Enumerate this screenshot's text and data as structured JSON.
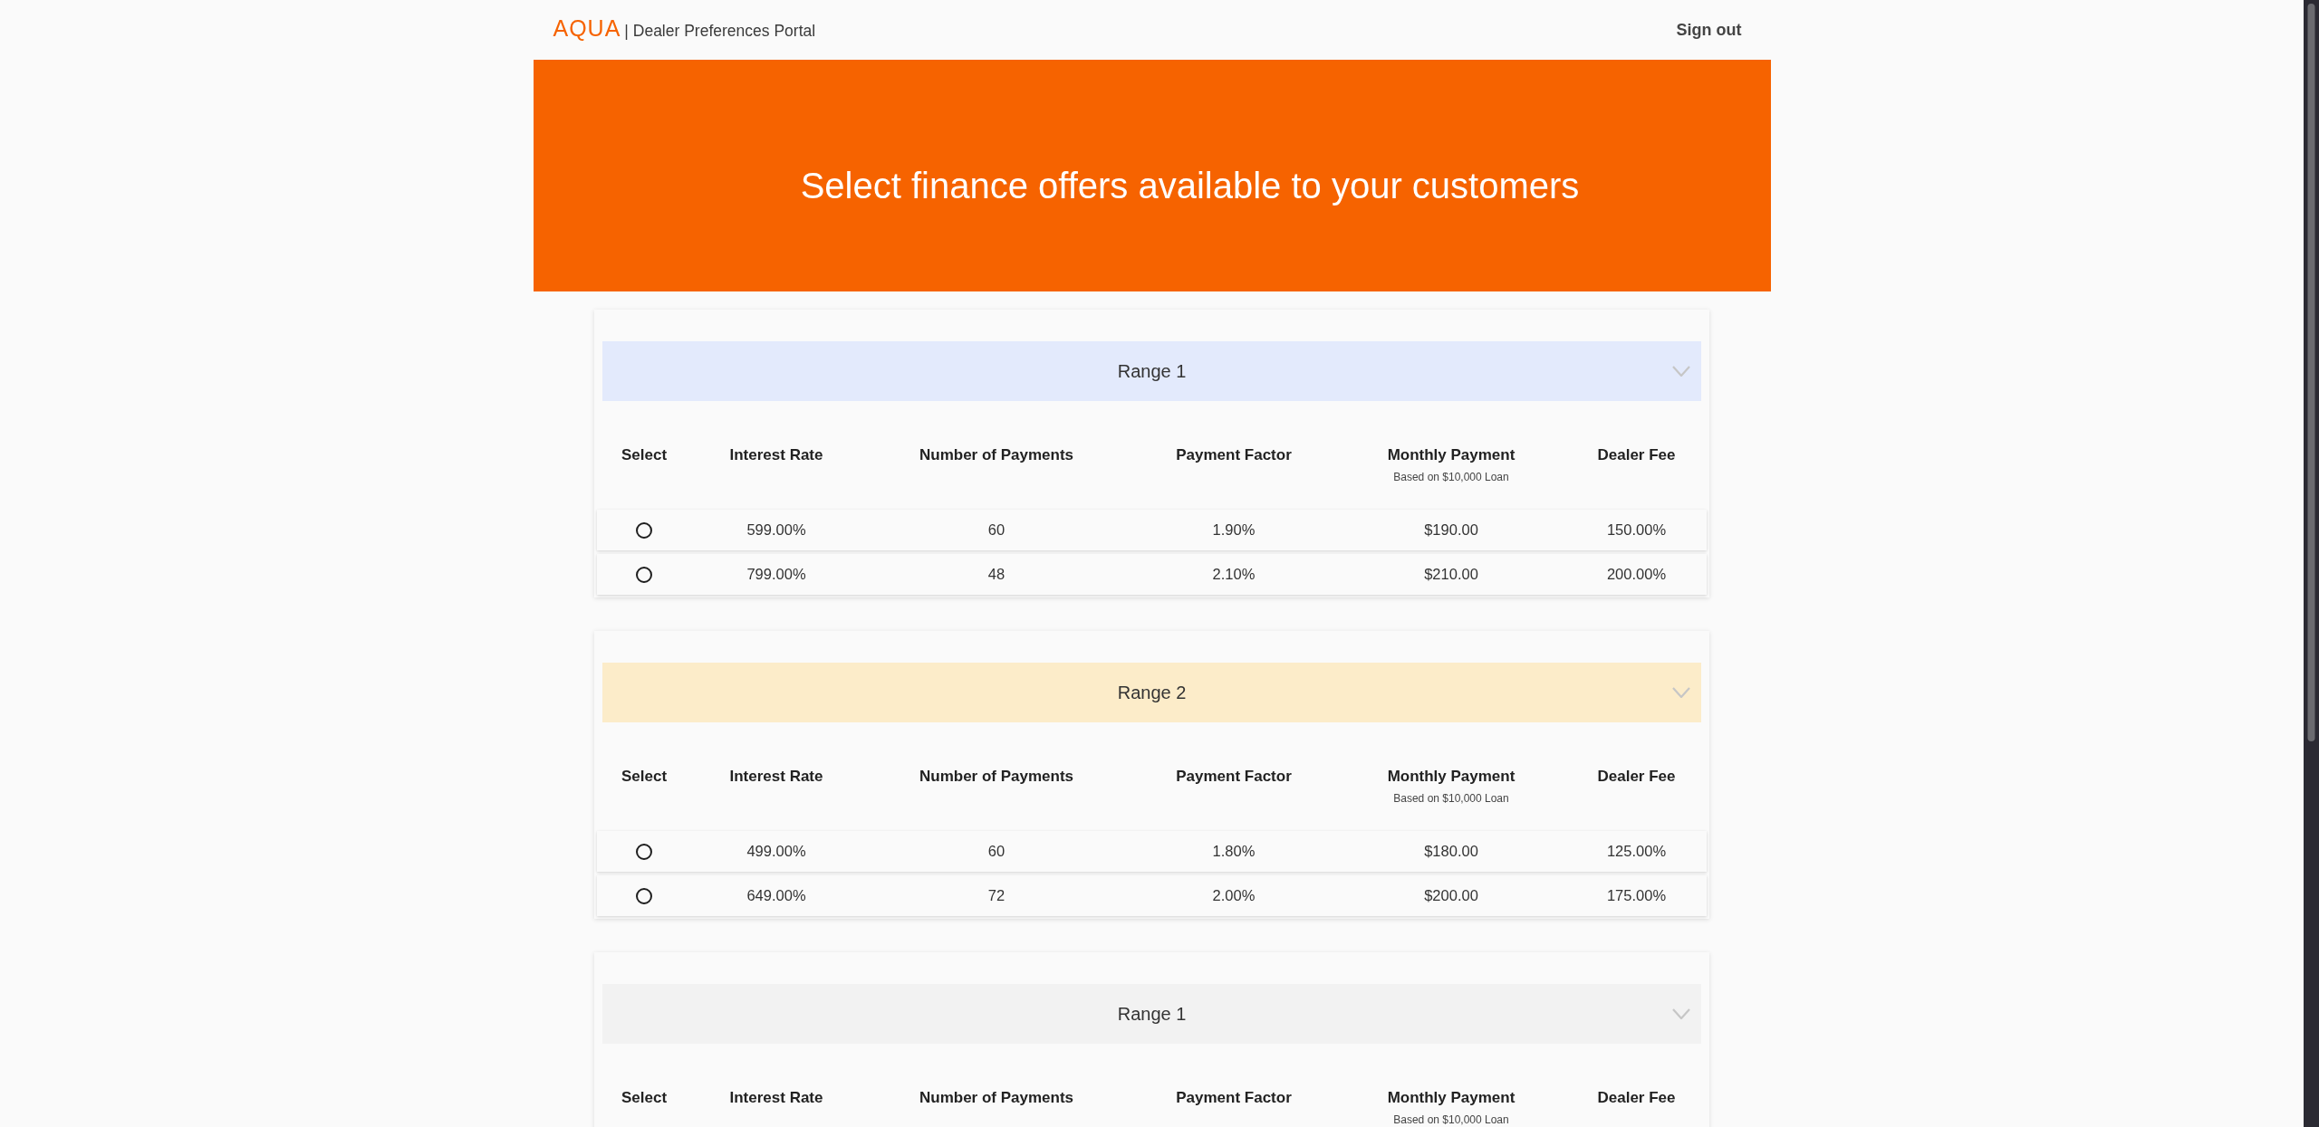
{
  "header": {
    "logo": "AQUA",
    "title": "| Dealer Preferences Portal",
    "sign_out": "Sign out"
  },
  "banner": {
    "heading": "Select finance offers available to your customers"
  },
  "ranges": [
    {
      "title": "Range 1",
      "color": "#e3eafc",
      "select_header": "Select",
      "columns": [
        {
          "label": "Interest Rate"
        },
        {
          "label": "Number of Payments"
        },
        {
          "label": "Payment Factor"
        },
        {
          "label": "Monthly Payment",
          "note": "Based on $10,000 Loan"
        },
        {
          "label": "Dealer Fee"
        }
      ],
      "rows": [
        {
          "selected": false,
          "cells": [
            "599.00%",
            "60",
            "1.90%",
            "$190.00",
            "150.00%"
          ]
        },
        {
          "selected": false,
          "cells": [
            "799.00%",
            "48",
            "2.10%",
            "$210.00",
            "200.00%"
          ]
        }
      ]
    },
    {
      "title": "Range 2",
      "color": "#fcecc9",
      "select_header": "Select",
      "columns": [
        {
          "label": "Interest Rate"
        },
        {
          "label": "Number of Payments"
        },
        {
          "label": "Payment Factor"
        },
        {
          "label": "Monthly Payment",
          "note": "Based on $10,000 Loan"
        },
        {
          "label": "Dealer Fee"
        }
      ],
      "rows": [
        {
          "selected": false,
          "cells": [
            "499.00%",
            "60",
            "1.80%",
            "$180.00",
            "125.00%"
          ]
        },
        {
          "selected": false,
          "cells": [
            "649.00%",
            "72",
            "2.00%",
            "$200.00",
            "175.00%"
          ]
        }
      ]
    },
    {
      "title": "Range 1",
      "color": "#f2f2f2",
      "select_header": "Select",
      "columns": [
        {
          "label": "Interest Rate"
        },
        {
          "label": "Number of Payments"
        },
        {
          "label": "Payment Factor"
        },
        {
          "label": "Monthly Payment",
          "note": "Based on $10,000 Loan"
        },
        {
          "label": "Dealer Fee"
        }
      ]
    }
  ]
}
